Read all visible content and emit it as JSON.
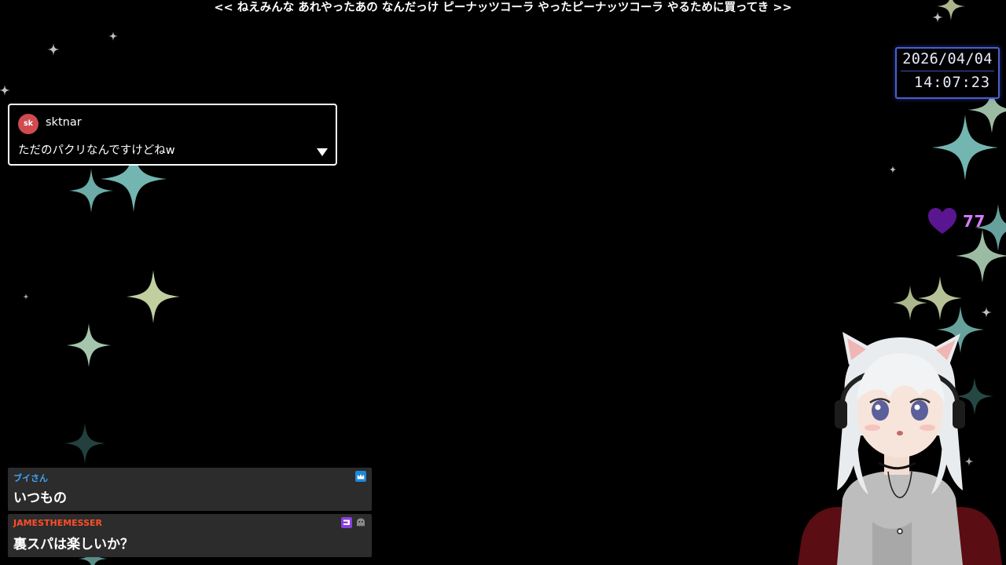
{
  "ticker": {
    "text": "<< ねえみんな あれやったあの なんだっけ ピーナッツコーラ やったピーナッツコーラ やるために買ってき >>"
  },
  "clock": {
    "date": "2026/04/04",
    "time": "14:07:23",
    "accent": "#4a5fd0"
  },
  "likes": {
    "count": "77",
    "icon": "heart-icon",
    "color": "#d77bff"
  },
  "pinned_comment": {
    "avatar_initials": "sk",
    "username": "sktnar",
    "text": "ただのパクリなんですけどねw",
    "avatar_color": "#cf4b4f"
  },
  "chat": {
    "messages": [
      {
        "author": "ブイさん",
        "author_color": "#3ea6ff",
        "text": "いつもの",
        "badges": [
          "crown-badge-icon"
        ]
      },
      {
        "author": "JAMESTHEMESSER",
        "author_color": "#ff4e2a",
        "text": "裏スパは楽しいか？",
        "badges": [
          "subscriber-badge-icon",
          "ghost-badge-icon"
        ]
      }
    ]
  }
}
